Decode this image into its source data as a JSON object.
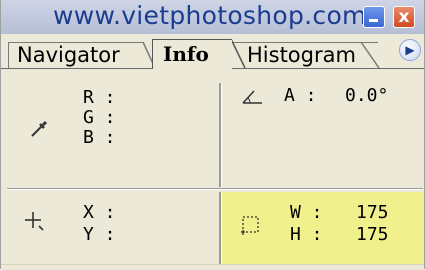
{
  "window": {
    "title": "www.vietphotoshop.com",
    "minimize_icon": "minimize-icon",
    "close_icon": "close-icon",
    "close_glyph": "x"
  },
  "tabs": [
    {
      "label": "Navigator",
      "active": false
    },
    {
      "label": "Info",
      "active": true
    },
    {
      "label": "Histogram",
      "active": false
    }
  ],
  "panel_menu_icon": "panel-menu-icon",
  "info": {
    "color": {
      "icon": "eyedropper-icon",
      "r_label": "R :",
      "r_value": "",
      "g_label": "G :",
      "g_value": "",
      "b_label": "B :",
      "b_value": ""
    },
    "angle": {
      "icon": "angle-icon",
      "label": "A :",
      "value": "0.0°"
    },
    "position": {
      "icon": "crosshair-icon",
      "x_label": "X :",
      "x_value": "",
      "y_label": "Y :",
      "y_value": ""
    },
    "size": {
      "icon": "marquee-icon",
      "w_label": "W :",
      "w_value": "175",
      "h_label": "H :",
      "h_value": "175",
      "highlight_color": "#f0f08c"
    }
  }
}
